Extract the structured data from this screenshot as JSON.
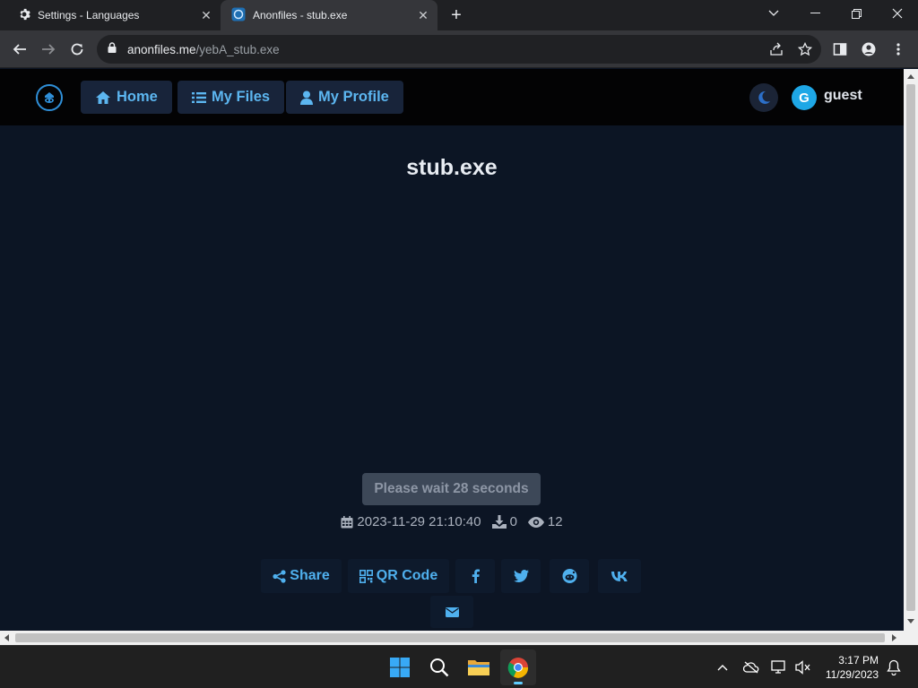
{
  "browser": {
    "tabs": [
      {
        "title": "Settings - Languages",
        "icon": "gear-icon",
        "active": false
      },
      {
        "title": "Anonfiles - stub.exe",
        "icon": "anonfiles-favicon",
        "active": true
      }
    ],
    "address": {
      "host": "anonfiles.me",
      "path": "/yebA_stub.exe"
    }
  },
  "site": {
    "nav": [
      {
        "label": "Home",
        "icon": "home-icon"
      },
      {
        "label": "My Files",
        "icon": "list-icon"
      },
      {
        "label": "My Profile",
        "icon": "user-icon"
      }
    ],
    "user": {
      "initial": "G",
      "name": "guest"
    }
  },
  "file": {
    "name": "stub.exe",
    "wait_label": "Please wait 28 seconds",
    "date": "2023-11-29 21:10:40",
    "downloads": "0",
    "views": "12"
  },
  "share": {
    "share_label": "Share",
    "qr_label": "QR Code",
    "networks": [
      "facebook-icon",
      "twitter-icon",
      "reddit-icon",
      "vk-icon",
      "email-icon"
    ]
  },
  "taskbar": {
    "time": "3:17 PM",
    "date": "11/29/2023"
  },
  "colors": {
    "page_bg": "#0c1524",
    "nav_bg": "#030304",
    "accent": "#4fb0ee",
    "avatar": "#1ea7e6"
  }
}
